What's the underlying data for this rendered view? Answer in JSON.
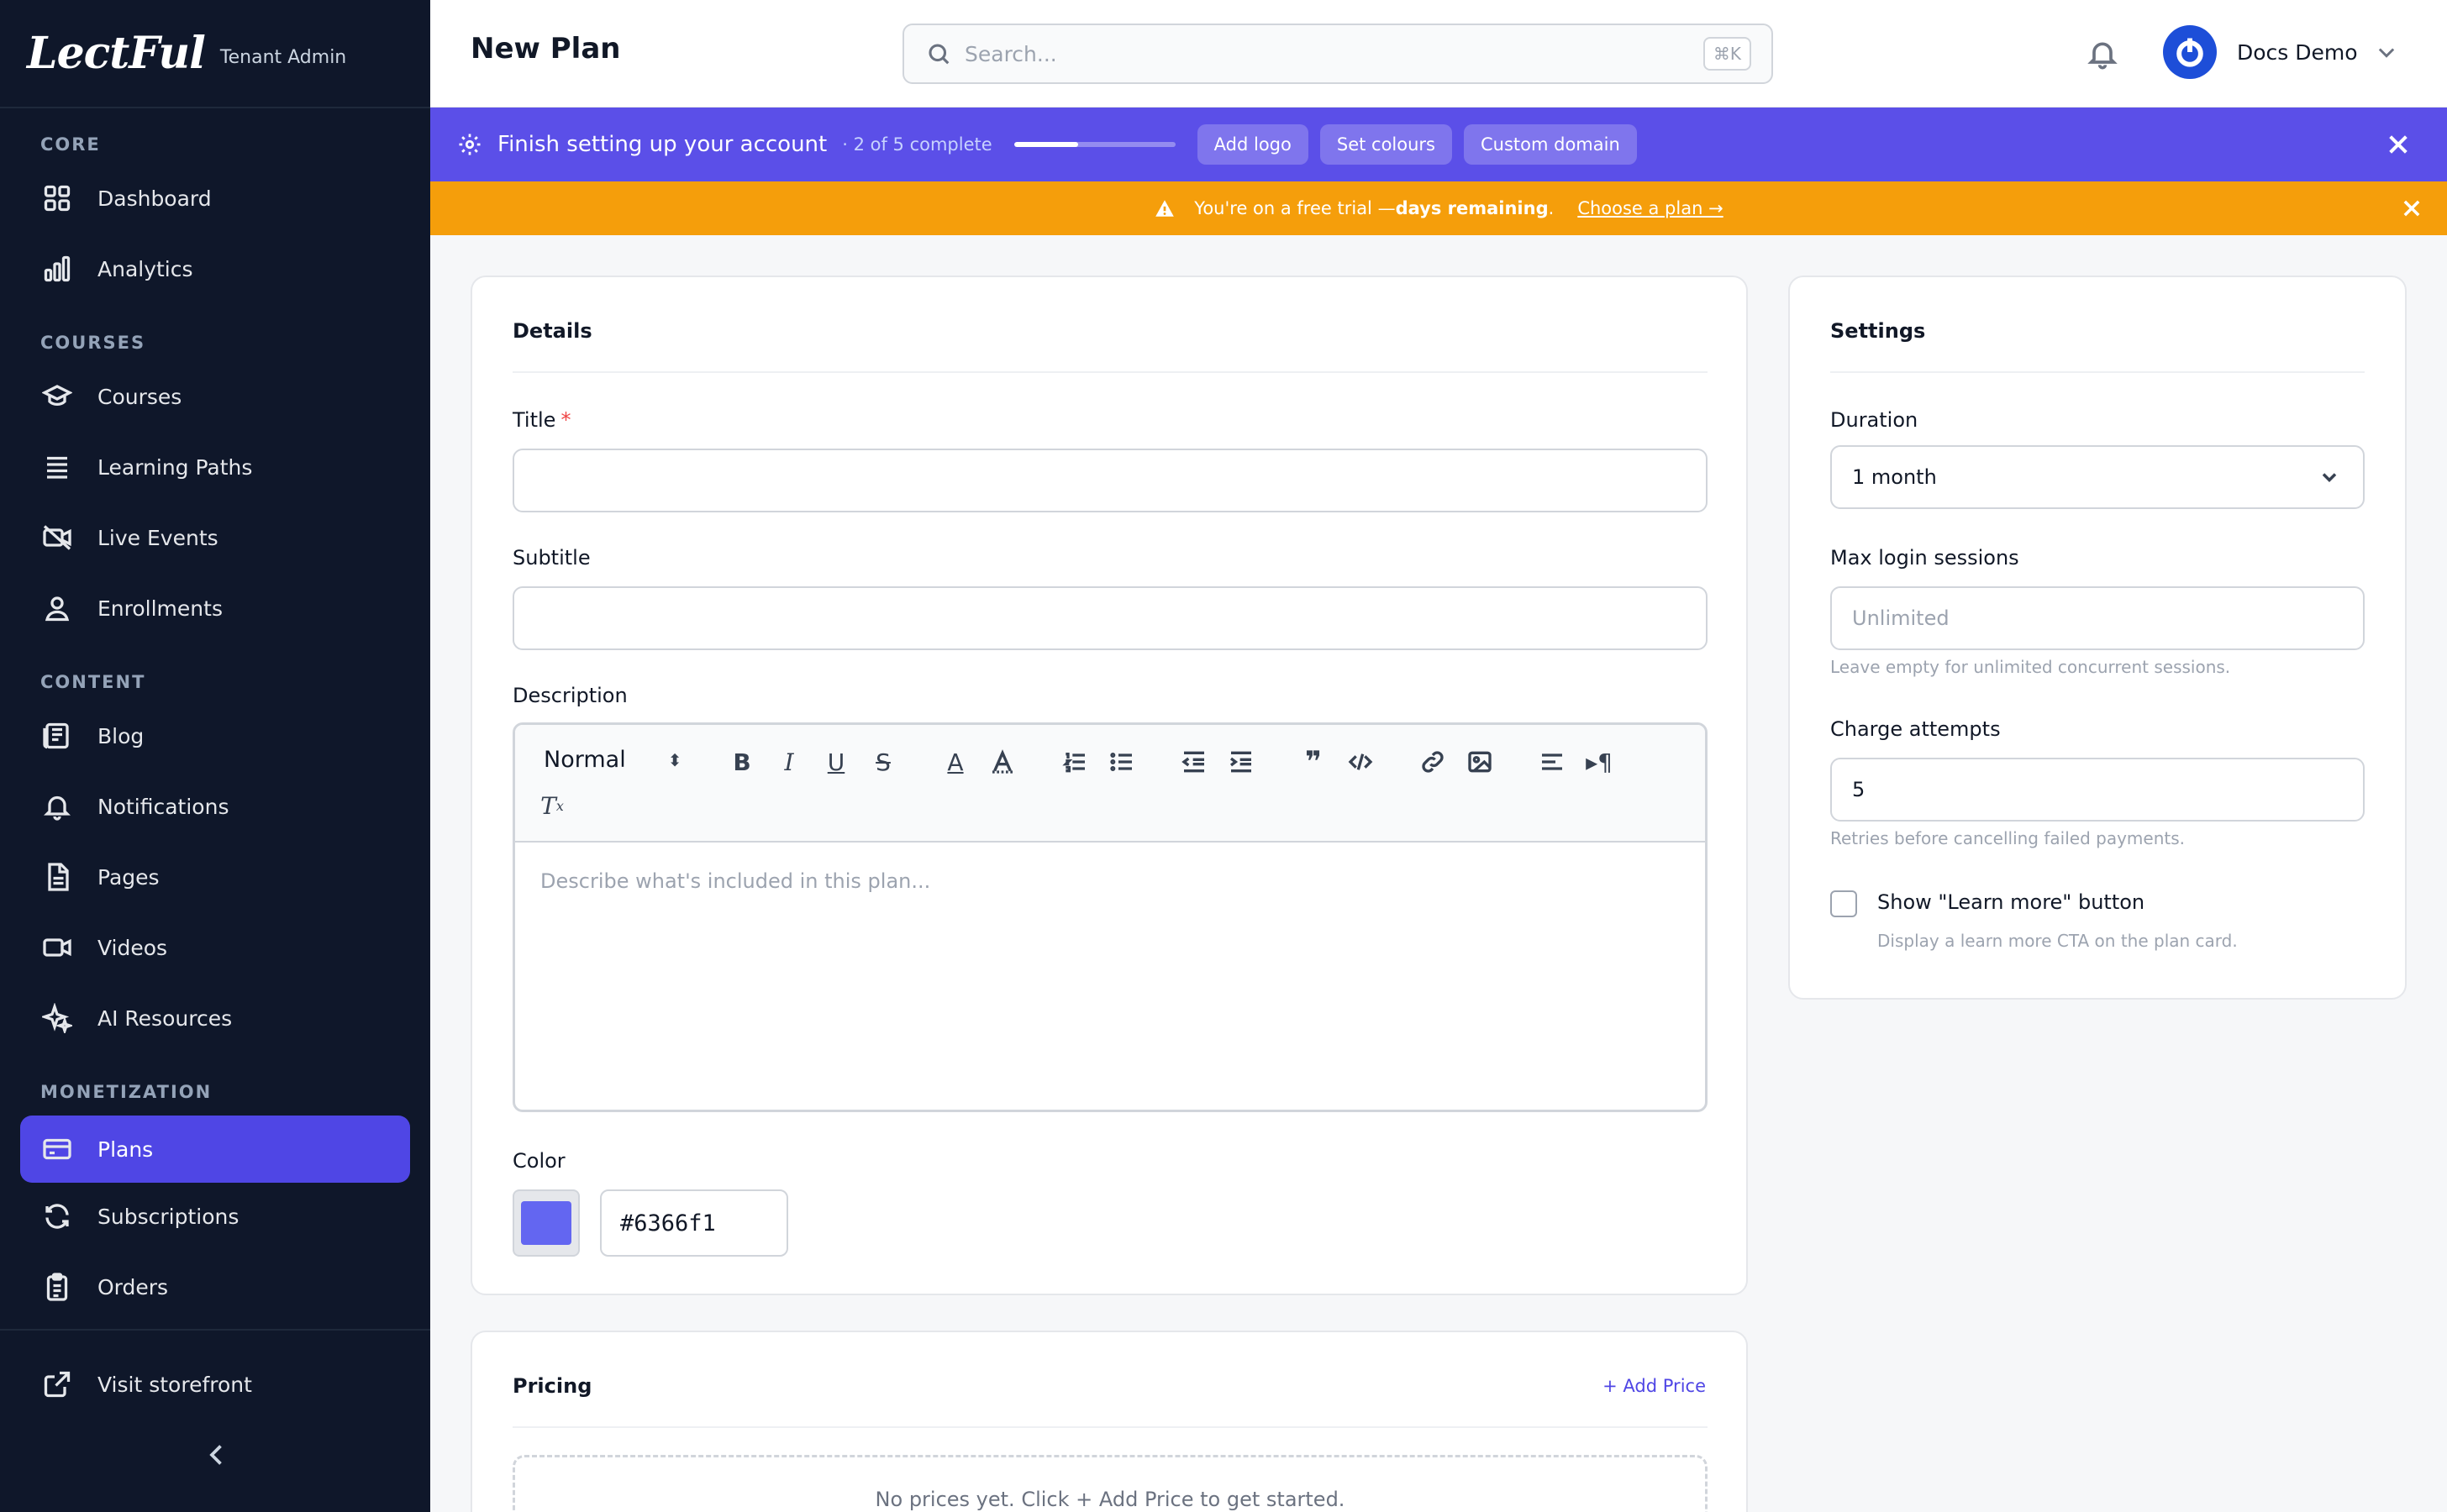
{
  "brand": {
    "logo_text": "LectFul",
    "tag": "Tenant Admin"
  },
  "sidebar": {
    "sections": {
      "core": "CORE",
      "courses": "COURSES",
      "content": "CONTENT",
      "monetization": "MONETIZATION"
    },
    "items": {
      "dashboard": {
        "label": "Dashboard",
        "icon": "grid-icon"
      },
      "analytics": {
        "label": "Analytics",
        "icon": "bar-chart-icon"
      },
      "courses": {
        "label": "Courses",
        "icon": "graduation-cap-icon"
      },
      "learning_paths": {
        "label": "Learning Paths",
        "icon": "list-icon"
      },
      "live_events": {
        "label": "Live Events",
        "icon": "video-off-icon"
      },
      "enrollments": {
        "label": "Enrollments",
        "icon": "user-icon"
      },
      "blog": {
        "label": "Blog",
        "icon": "newspaper-icon"
      },
      "notifications": {
        "label": "Notifications",
        "icon": "bell-icon"
      },
      "pages": {
        "label": "Pages",
        "icon": "file-icon"
      },
      "videos": {
        "label": "Videos",
        "icon": "video-icon"
      },
      "ai_resources": {
        "label": "AI Resources",
        "icon": "sparkles-icon"
      },
      "plans": {
        "label": "Plans",
        "icon": "credit-card-icon"
      },
      "subscriptions": {
        "label": "Subscriptions",
        "icon": "refresh-icon"
      },
      "orders": {
        "label": "Orders",
        "icon": "clipboard-icon"
      }
    },
    "visit_storefront": "Visit storefront",
    "active": "plans"
  },
  "header": {
    "title": "New Plan",
    "search_placeholder": "Search...",
    "search_shortcut": "⌘K",
    "user_name": "Docs Demo"
  },
  "setup_banner": {
    "title": "Finish setting up your account",
    "progress_text": "· 2 of 5 complete",
    "progress_fraction": 0.4,
    "chips": [
      "Add logo",
      "Set colours",
      "Custom domain"
    ]
  },
  "trial_banner": {
    "prefix": "You're on a free trial — ",
    "bold": "days remaining",
    "suffix": ".",
    "cta": "Choose a plan →"
  },
  "details": {
    "title": "Details",
    "title_label": "Title",
    "required_mark": "*",
    "subtitle_label": "Subtitle",
    "description_label": "Description",
    "editor_format": "Normal",
    "editor_placeholder": "Describe what's included in this plan...",
    "color_label": "Color",
    "color_value": "#6366f1"
  },
  "settings": {
    "title": "Settings",
    "duration_label": "Duration",
    "duration_value": "1 month",
    "max_sessions_label": "Max login sessions",
    "max_sessions_placeholder": "Unlimited",
    "max_sessions_hint": "Leave empty for unlimited concurrent sessions.",
    "charge_attempts_label": "Charge attempts",
    "charge_attempts_value": "5",
    "charge_attempts_hint": "Retries before cancelling failed payments.",
    "learn_more_label": "Show \"Learn more\" button",
    "learn_more_hint": "Display a learn more CTA on the plan card.",
    "learn_more_checked": false
  },
  "pricing": {
    "title": "Pricing",
    "add_price": "+ Add Price",
    "empty_text": "No prices yet. Click + Add Price to get started."
  },
  "colors": {
    "sidebar_bg": "#0f172a",
    "accent": "#4f46e5",
    "setup_banner": "#5b4fe8",
    "trial_banner": "#f59e0b"
  }
}
